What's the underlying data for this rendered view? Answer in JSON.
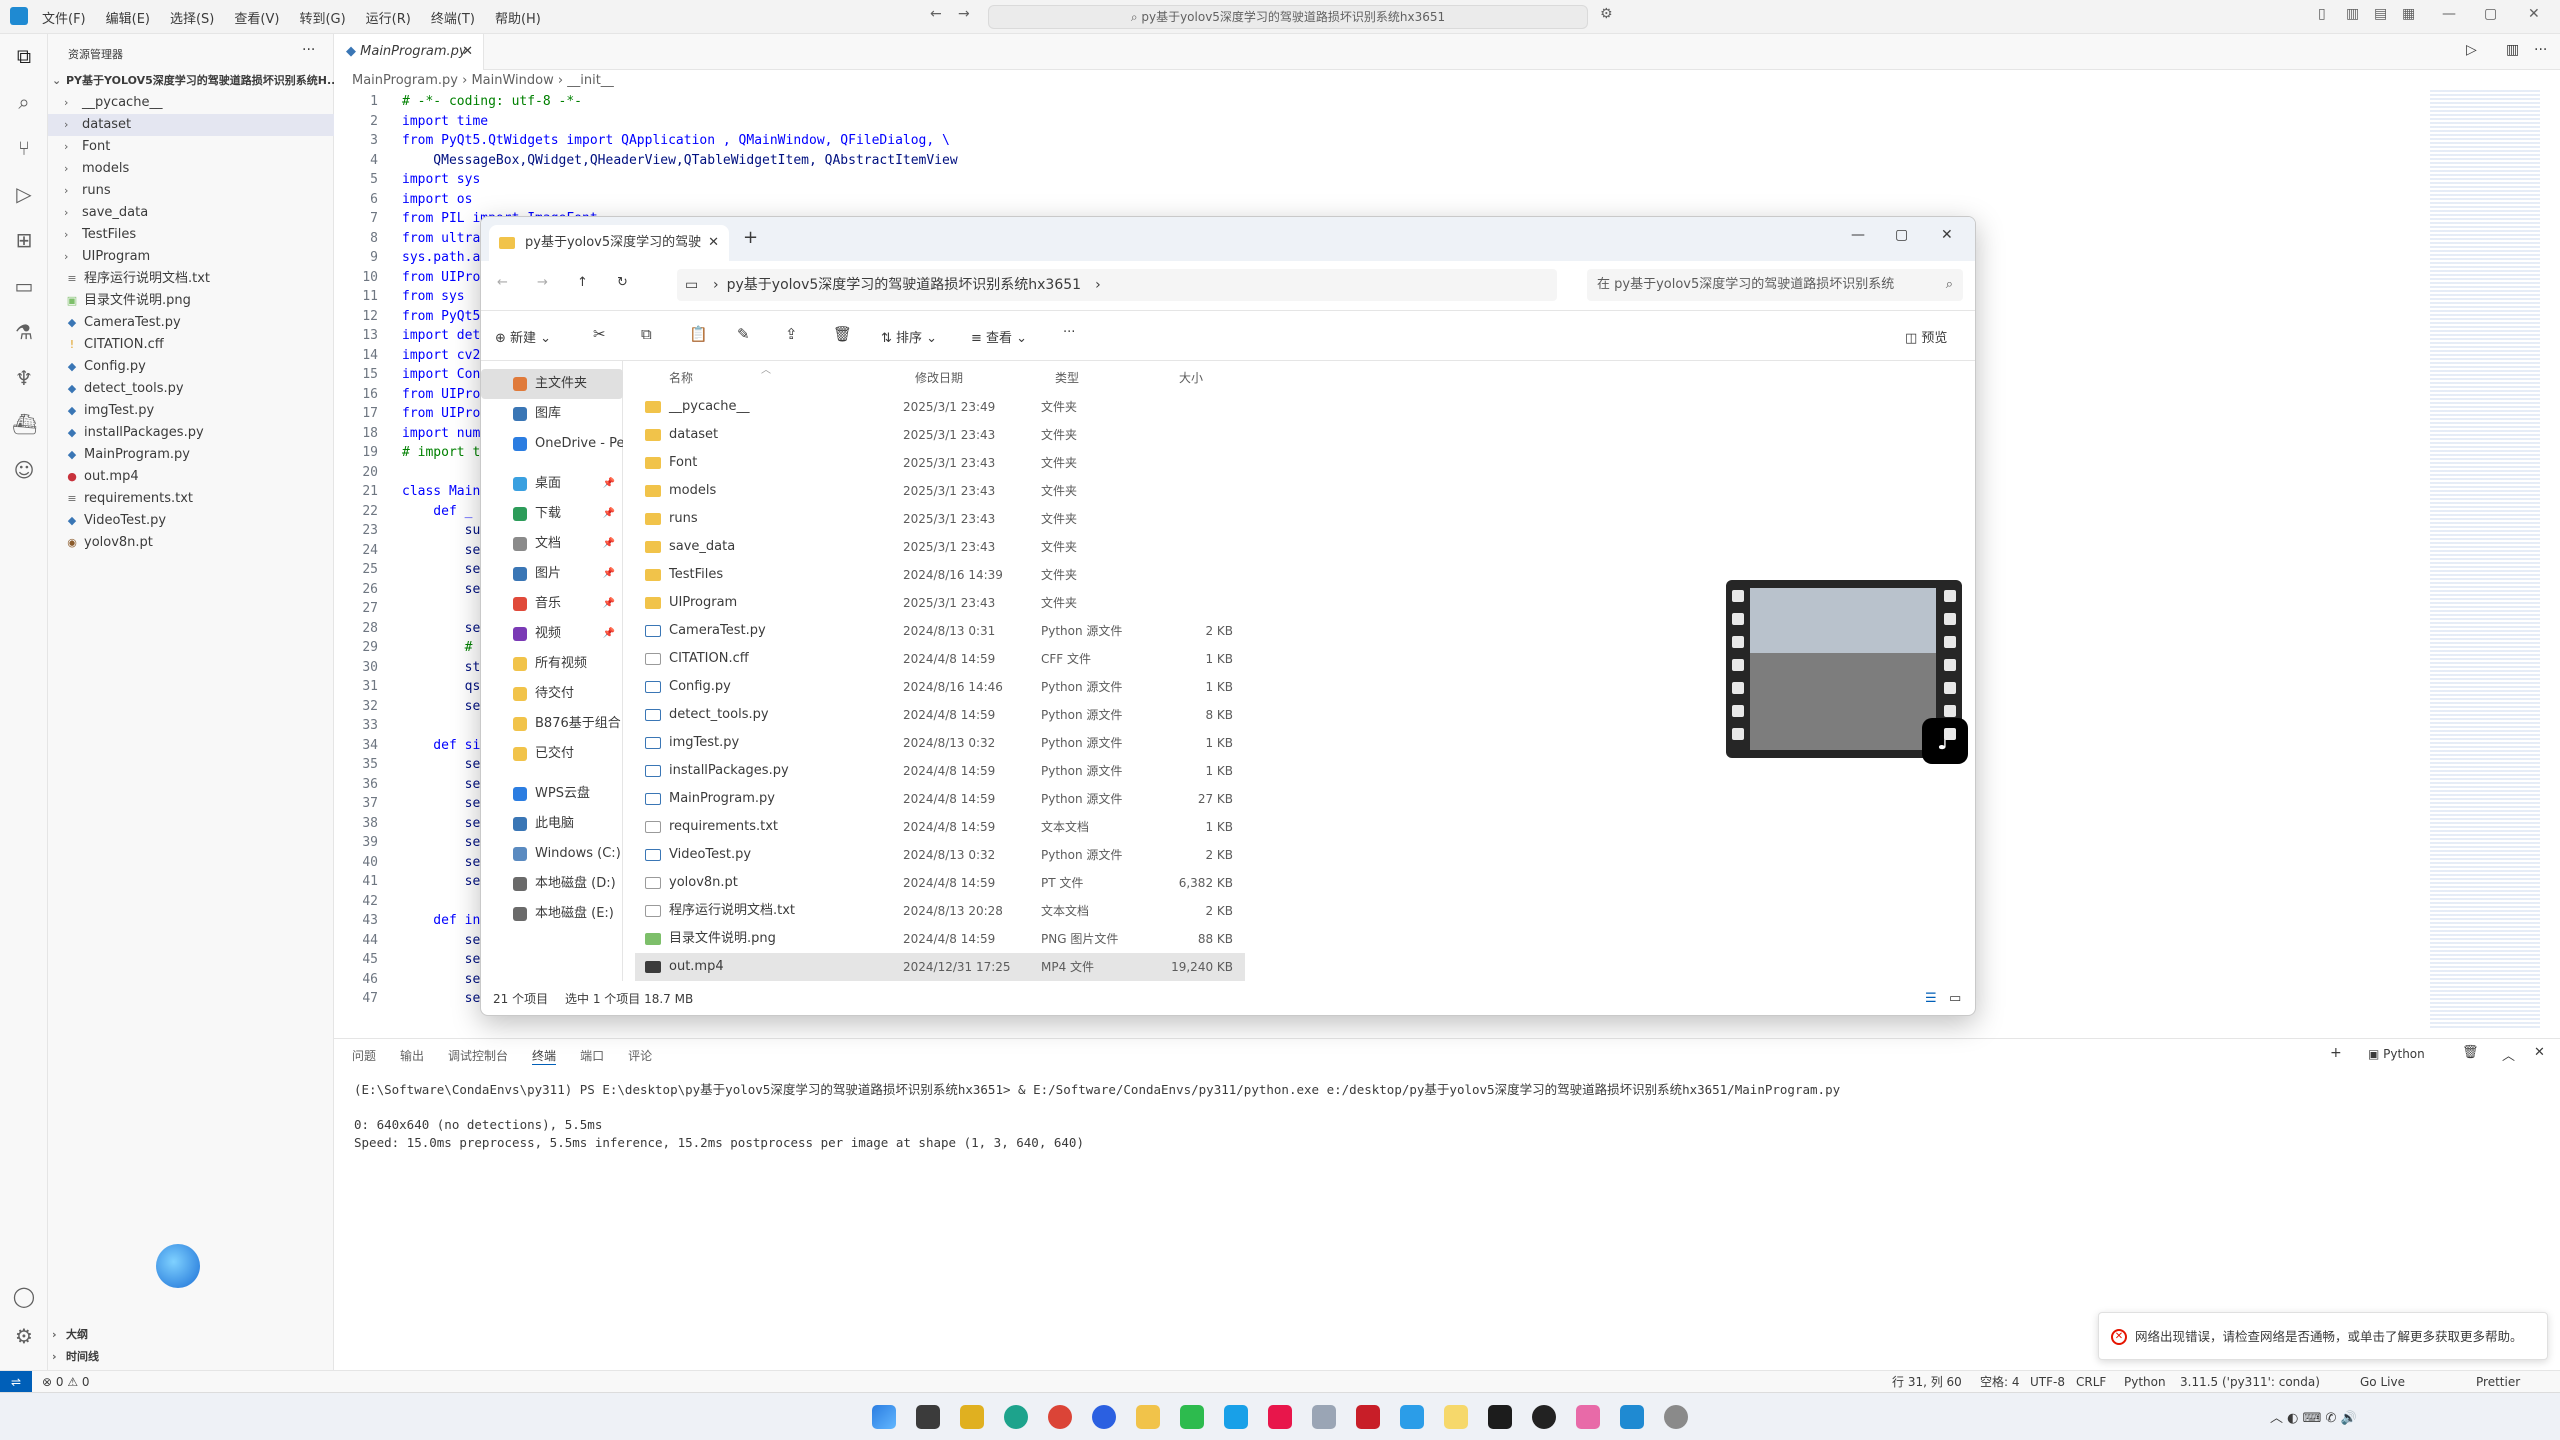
{
  "menu": [
    "文件(F)",
    "编辑(E)",
    "选择(S)",
    "查看(V)",
    "转到(G)",
    "运行(R)",
    "终端(T)",
    "帮助(H)"
  ],
  "title_search": "py基于yolov5深度学习的驾驶道路损坏识别系统hx3651",
  "sidebar": {
    "header": "资源管理器",
    "root": "PY基于YOLOV5深度学习的驾驶道路损坏识别系统H...",
    "items": [
      {
        "label": "__pycache__",
        "type": "folder"
      },
      {
        "label": "dataset",
        "type": "folder"
      },
      {
        "label": "Font",
        "type": "folder"
      },
      {
        "label": "models",
        "type": "folder"
      },
      {
        "label": "runs",
        "type": "folder"
      },
      {
        "label": "save_data",
        "type": "folder"
      },
      {
        "label": "TestFiles",
        "type": "folder"
      },
      {
        "label": "UIProgram",
        "type": "folder"
      },
      {
        "label": "程序运行说明文档.txt",
        "type": "txt"
      },
      {
        "label": "目录文件说明.png",
        "type": "png"
      },
      {
        "label": "CameraTest.py",
        "type": "py"
      },
      {
        "label": "CITATION.cff",
        "type": "cff"
      },
      {
        "label": "Config.py",
        "type": "py"
      },
      {
        "label": "detect_tools.py",
        "type": "py"
      },
      {
        "label": "imgTest.py",
        "type": "py"
      },
      {
        "label": "installPackages.py",
        "type": "py"
      },
      {
        "label": "MainProgram.py",
        "type": "py"
      },
      {
        "label": "out.mp4",
        "type": "mp4"
      },
      {
        "label": "requirements.txt",
        "type": "txt"
      },
      {
        "label": "VideoTest.py",
        "type": "py"
      },
      {
        "label": "yolov8n.pt",
        "type": "pt"
      }
    ],
    "outline": "大纲",
    "timeline": "时间线"
  },
  "editor": {
    "tab": "MainProgram.py",
    "breadcrumb": [
      "MainProgram.py",
      "MainWindow",
      "__init__"
    ],
    "lines": [
      {
        "n": "1",
        "t": "# -*- coding: utf-8 -*-"
      },
      {
        "n": "2",
        "t": "import time"
      },
      {
        "n": "3",
        "t": "from PyQt5.QtWidgets import QApplication , QMainWindow, QFileDialog, \\"
      },
      {
        "n": "4",
        "t": "    QMessageBox,QWidget,QHeaderView,QTableWidgetItem, QAbstractItemView"
      },
      {
        "n": "5",
        "t": "import sys"
      },
      {
        "n": "6",
        "t": "import os"
      },
      {
        "n": "7",
        "t": "from PIL import ImageFont"
      },
      {
        "n": "8",
        "t": "from ultra"
      },
      {
        "n": "9",
        "t": "sys.path.a"
      },
      {
        "n": "10",
        "t": "from UIPro"
      },
      {
        "n": "11",
        "t": "from sys"
      },
      {
        "n": "12",
        "t": "from PyQt5"
      },
      {
        "n": "13",
        "t": "import det"
      },
      {
        "n": "14",
        "t": "import cv2"
      },
      {
        "n": "15",
        "t": "import Con"
      },
      {
        "n": "16",
        "t": "from UIPro"
      },
      {
        "n": "17",
        "t": "from UIPro"
      },
      {
        "n": "18",
        "t": "import num"
      },
      {
        "n": "19",
        "t": "# import t"
      },
      {
        "n": "20",
        "t": ""
      },
      {
        "n": "21",
        "t": "class Main"
      },
      {
        "n": "22",
        "t": "    def _"
      },
      {
        "n": "23",
        "t": "        su"
      },
      {
        "n": "24",
        "t": "        se"
      },
      {
        "n": "25",
        "t": "        se"
      },
      {
        "n": "26",
        "t": "        se"
      },
      {
        "n": "27",
        "t": ""
      },
      {
        "n": "28",
        "t": "        se"
      },
      {
        "n": "29",
        "t": "        #"
      },
      {
        "n": "30",
        "t": "        st"
      },
      {
        "n": "31",
        "t": "        qs"
      },
      {
        "n": "32",
        "t": "        se"
      },
      {
        "n": "33",
        "t": ""
      },
      {
        "n": "34",
        "t": "    def si"
      },
      {
        "n": "35",
        "t": "        se"
      },
      {
        "n": "36",
        "t": "        se"
      },
      {
        "n": "37",
        "t": "        se"
      },
      {
        "n": "38",
        "t": "        se"
      },
      {
        "n": "39",
        "t": "        se"
      },
      {
        "n": "40",
        "t": "        se"
      },
      {
        "n": "41",
        "t": "        se"
      },
      {
        "n": "42",
        "t": ""
      },
      {
        "n": "43",
        "t": "    def in"
      },
      {
        "n": "44",
        "t": "        se"
      },
      {
        "n": "45",
        "t": "        se"
      },
      {
        "n": "46",
        "t": "        se"
      },
      {
        "n": "47",
        "t": "        self.org_path = None"
      }
    ]
  },
  "panel": {
    "tabs": [
      "问题",
      "输出",
      "调试控制台",
      "终端",
      "端口",
      "评论"
    ],
    "active_tab": "终端",
    "shell_label": "Python",
    "lines": [
      "(E:\\Software\\CondaEnvs\\py311) PS E:\\desktop\\py基于yolov5深度学习的驾驶道路损坏识别系统hx3651> & E:/Software/CondaEnvs/py311/python.exe e:/desktop/py基于yolov5深度学习的驾驶道路损坏识别系统hx3651/MainProgram.py",
      "0: 640x640 (no detections), 5.5ms",
      "Speed: 15.0ms preprocess, 5.5ms inference, 15.2ms postprocess per image at shape (1, 3, 640, 640)"
    ]
  },
  "statusbar": {
    "problems": "⊗ 0 ⚠ 0",
    "position": "行 31, 列 60",
    "spaces": "空格: 4",
    "encoding": "UTF-8",
    "eol": "CRLF",
    "language": "Python",
    "interpreter": "3.11.5 ('py311': conda)",
    "golive": "Go Live",
    "prettier": "Prettier"
  },
  "explorer": {
    "tab_title": "py基于yolov5深度学习的驾驶",
    "address": "py基于yolov5深度学习的驾驶道路损坏识别系统hx3651",
    "search_placeholder": "在 py基于yolov5深度学习的驾驶道路损坏识别系统",
    "cmd": {
      "new": "新建",
      "sort": "排序",
      "view": "查看",
      "preview": "预览"
    },
    "nav": [
      {
        "label": "主文件夹",
        "color": "#e07a3a",
        "pin": false,
        "sel": true
      },
      {
        "label": "图库",
        "color": "#3a76b5",
        "pin": false,
        "sel": false
      },
      {
        "label": "OneDrive - Per",
        "color": "#2b7de1",
        "pin": false,
        "sel": false
      },
      {
        "label": "桌面",
        "color": "#3aa0e0",
        "pin": true,
        "sel": false
      },
      {
        "label": "下载",
        "color": "#2d9c5a",
        "pin": true,
        "sel": false
      },
      {
        "label": "文档",
        "color": "#8a8a8a",
        "pin": true,
        "sel": false
      },
      {
        "label": "图片",
        "color": "#3a76b5",
        "pin": true,
        "sel": false
      },
      {
        "label": "音乐",
        "color": "#e04a3a",
        "pin": true,
        "sel": false
      },
      {
        "label": "视频",
        "color": "#7a3ab5",
        "pin": true,
        "sel": false
      },
      {
        "label": "所有视频",
        "color": "#f1c34a",
        "pin": false,
        "sel": false
      },
      {
        "label": "待交付",
        "color": "#f1c34a",
        "pin": false,
        "sel": false
      },
      {
        "label": "B876基于组合",
        "color": "#f1c34a",
        "pin": false,
        "sel": false
      },
      {
        "label": "已交付",
        "color": "#f1c34a",
        "pin": false,
        "sel": false
      },
      {
        "label": "WPS云盘",
        "color": "#2b7de1",
        "pin": false,
        "sel": false
      },
      {
        "label": "此电脑",
        "color": "#3a76b5",
        "pin": false,
        "sel": false
      },
      {
        "label": "Windows (C:)",
        "color": "#5a8ac0",
        "pin": false,
        "sel": false
      },
      {
        "label": "本地磁盘 (D:)",
        "color": "#6a6a6a",
        "pin": false,
        "sel": false
      },
      {
        "label": "本地磁盘 (E:)",
        "color": "#6a6a6a",
        "pin": false,
        "sel": false
      }
    ],
    "columns": {
      "name": "名称",
      "date": "修改日期",
      "type": "类型",
      "size": "大小"
    },
    "files": [
      {
        "name": "__pycache__",
        "date": "2025/3/1 23:49",
        "type": "文件夹",
        "size": "",
        "icon": "folder"
      },
      {
        "name": "dataset",
        "date": "2025/3/1 23:43",
        "type": "文件夹",
        "size": "",
        "icon": "folder"
      },
      {
        "name": "Font",
        "date": "2025/3/1 23:43",
        "type": "文件夹",
        "size": "",
        "icon": "folder"
      },
      {
        "name": "models",
        "date": "2025/3/1 23:43",
        "type": "文件夹",
        "size": "",
        "icon": "folder"
      },
      {
        "name": "runs",
        "date": "2025/3/1 23:43",
        "type": "文件夹",
        "size": "",
        "icon": "folder"
      },
      {
        "name": "save_data",
        "date": "2025/3/1 23:43",
        "type": "文件夹",
        "size": "",
        "icon": "folder"
      },
      {
        "name": "TestFiles",
        "date": "2024/8/16 14:39",
        "type": "文件夹",
        "size": "",
        "icon": "folder"
      },
      {
        "name": "UIProgram",
        "date": "2025/3/1 23:43",
        "type": "文件夹",
        "size": "",
        "icon": "folder"
      },
      {
        "name": "CameraTest.py",
        "date": "2024/8/13 0:31",
        "type": "Python 源文件",
        "size": "2 KB",
        "icon": "py"
      },
      {
        "name": "CITATION.cff",
        "date": "2024/4/8 14:59",
        "type": "CFF 文件",
        "size": "1 KB",
        "icon": "file"
      },
      {
        "name": "Config.py",
        "date": "2024/8/16 14:46",
        "type": "Python 源文件",
        "size": "1 KB",
        "icon": "py"
      },
      {
        "name": "detect_tools.py",
        "date": "2024/4/8 14:59",
        "type": "Python 源文件",
        "size": "8 KB",
        "icon": "py"
      },
      {
        "name": "imgTest.py",
        "date": "2024/8/13 0:32",
        "type": "Python 源文件",
        "size": "1 KB",
        "icon": "py"
      },
      {
        "name": "installPackages.py",
        "date": "2024/4/8 14:59",
        "type": "Python 源文件",
        "size": "1 KB",
        "icon": "py"
      },
      {
        "name": "MainProgram.py",
        "date": "2024/4/8 14:59",
        "type": "Python 源文件",
        "size": "27 KB",
        "icon": "py"
      },
      {
        "name": "requirements.txt",
        "date": "2024/4/8 14:59",
        "type": "文本文档",
        "size": "1 KB",
        "icon": "file"
      },
      {
        "name": "VideoTest.py",
        "date": "2024/8/13 0:32",
        "type": "Python 源文件",
        "size": "2 KB",
        "icon": "py"
      },
      {
        "name": "yolov8n.pt",
        "date": "2024/4/8 14:59",
        "type": "PT 文件",
        "size": "6,382 KB",
        "icon": "file"
      },
      {
        "name": "程序运行说明文档.txt",
        "date": "2024/8/13 20:28",
        "type": "文本文档",
        "size": "2 KB",
        "icon": "file"
      },
      {
        "name": "目录文件说明.png",
        "date": "2024/4/8 14:59",
        "type": "PNG 图片文件",
        "size": "88 KB",
        "icon": "png"
      },
      {
        "name": "out.mp4",
        "date": "2024/12/31 17:25",
        "type": "MP4 文件",
        "size": "19,240 KB",
        "icon": "mp4"
      }
    ],
    "status": {
      "count": "21 个项目",
      "selected": "选中 1 个项目  18.7 MB"
    }
  },
  "notification": "网络出现错误，请检查网络是否通畅，或单击了解更多获取更多帮助。",
  "colors": {
    "accent": "#005fb8",
    "folder": "#f1c34a",
    "error": "#e51400"
  }
}
